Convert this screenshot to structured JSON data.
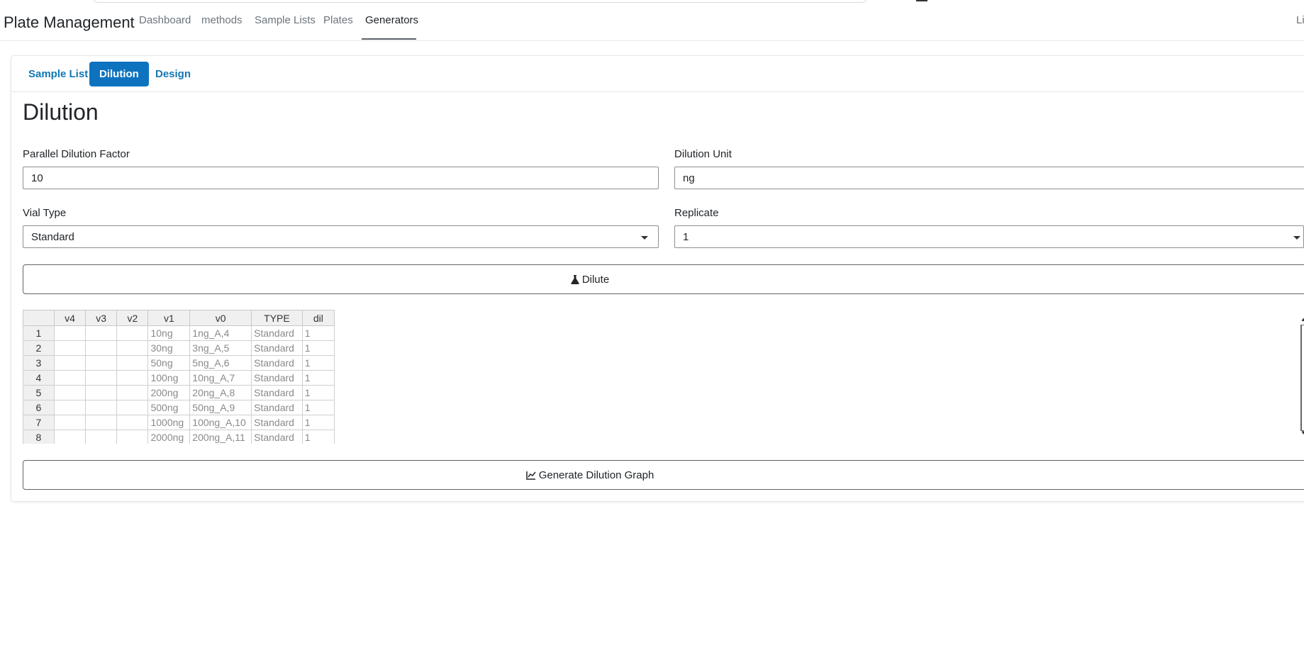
{
  "app": {
    "brand": "Plate Management",
    "right_item": "Li"
  },
  "nav": {
    "items": [
      "Dashboard",
      "methods",
      "Sample Lists",
      "Plates",
      "Generators"
    ],
    "active": "Generators"
  },
  "tabs": [
    "Sample List",
    "Dilution",
    "Design"
  ],
  "active_tab": "Dilution",
  "page": {
    "title": "Dilution"
  },
  "form": {
    "parallel_dilution_factor": {
      "label": "Parallel Dilution Factor",
      "value": "10"
    },
    "dilution_unit": {
      "label": "Dilution Unit",
      "value": "ng"
    },
    "vial_type": {
      "label": "Vial Type",
      "value": "Standard"
    },
    "replicate": {
      "label": "Replicate",
      "value": "1"
    }
  },
  "buttons": {
    "dilute": "Dilute",
    "generate_graph": "Generate Dilution Graph"
  },
  "table": {
    "columns": [
      "",
      "v4",
      "v3",
      "v2",
      "v1",
      "v0",
      "TYPE",
      "dil"
    ],
    "rows": [
      [
        "1",
        "",
        "",
        "",
        "10ng",
        "1ng_A,4",
        "Standard",
        "1"
      ],
      [
        "2",
        "",
        "",
        "",
        "30ng",
        "3ng_A,5",
        "Standard",
        "1"
      ],
      [
        "3",
        "",
        "",
        "",
        "50ng",
        "5ng_A,6",
        "Standard",
        "1"
      ],
      [
        "4",
        "",
        "",
        "",
        "100ng",
        "10ng_A,7",
        "Standard",
        "1"
      ],
      [
        "5",
        "",
        "",
        "",
        "200ng",
        "20ng_A,8",
        "Standard",
        "1"
      ],
      [
        "6",
        "",
        "",
        "",
        "500ng",
        "50ng_A,9",
        "Standard",
        "1"
      ],
      [
        "7",
        "",
        "",
        "",
        "1000ng",
        "100ng_A,10",
        "Standard",
        "1"
      ],
      [
        "8",
        "",
        "",
        "",
        "2000ng",
        "200ng_A,11",
        "Standard",
        "1"
      ]
    ]
  },
  "colors": {
    "primary": "#0d73bf",
    "link": "#1277b4",
    "muted": "#6c757d"
  }
}
